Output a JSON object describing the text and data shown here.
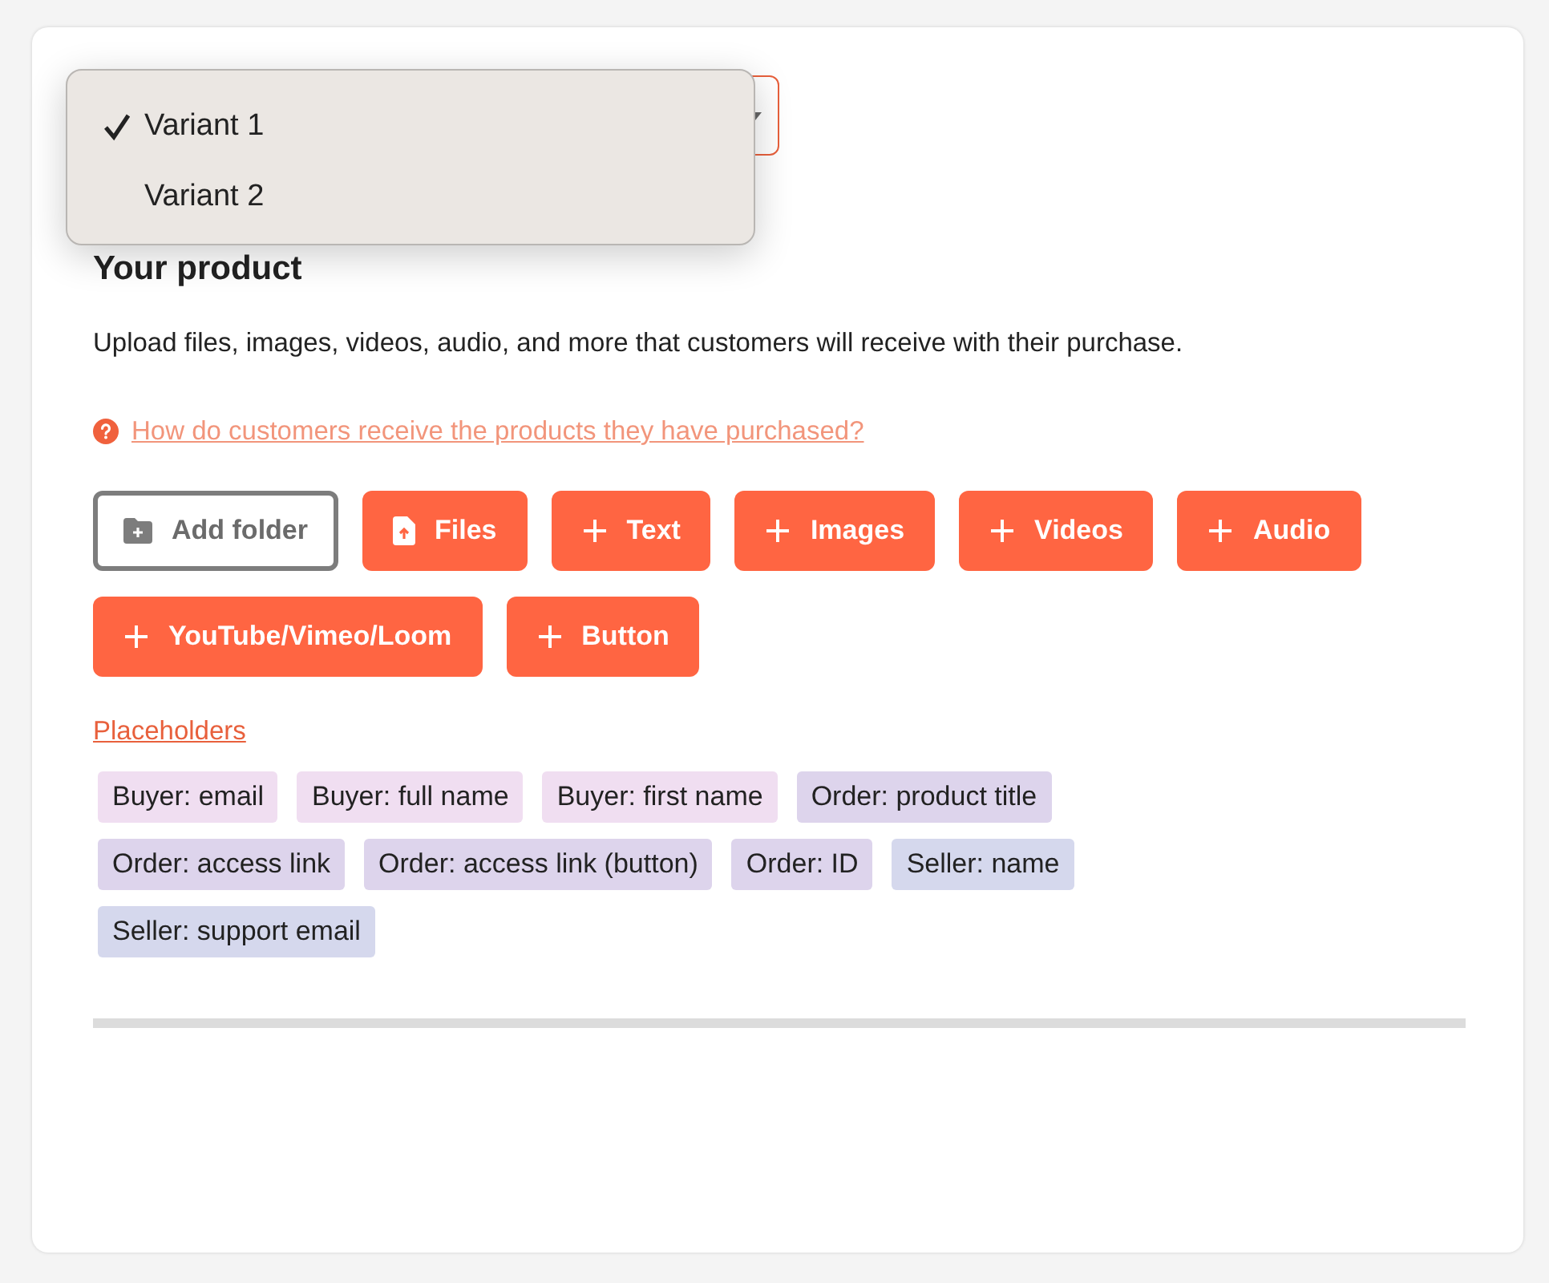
{
  "variant_select": {
    "options": [
      {
        "label": "Variant 1",
        "selected": true
      },
      {
        "label": "Variant 2",
        "selected": false
      }
    ]
  },
  "heading": "Your product",
  "description": "Upload files, images, videos, audio, and more that customers will receive with their purchase.",
  "help_link": "How do customers receive the products they have purchased?",
  "buttons": [
    {
      "kind": "folder",
      "label": "Add folder"
    },
    {
      "kind": "file",
      "label": "Files"
    },
    {
      "kind": "add",
      "label": "Text"
    },
    {
      "kind": "add",
      "label": "Images"
    },
    {
      "kind": "add",
      "label": "Videos"
    },
    {
      "kind": "add",
      "label": "Audio"
    },
    {
      "kind": "add",
      "label": "YouTube/Vimeo/Loom"
    },
    {
      "kind": "add",
      "label": "Button"
    }
  ],
  "placeholders_link": "Placeholders",
  "placeholders": [
    {
      "label": "Buyer: email",
      "color": "#f0def1"
    },
    {
      "label": "Buyer: full name",
      "color": "#f0def1"
    },
    {
      "label": "Buyer: first name",
      "color": "#f0def1"
    },
    {
      "label": "Order: product title",
      "color": "#ddd4ec"
    },
    {
      "label": "Order: access link",
      "color": "#ddd4ec"
    },
    {
      "label": "Order: access link (button)",
      "color": "#ddd4ec"
    },
    {
      "label": "Order: ID",
      "color": "#ddd4ec"
    },
    {
      "label": "Seller: name",
      "color": "#d5d8ed"
    },
    {
      "label": "Seller: support email",
      "color": "#d5d8ed"
    }
  ]
}
